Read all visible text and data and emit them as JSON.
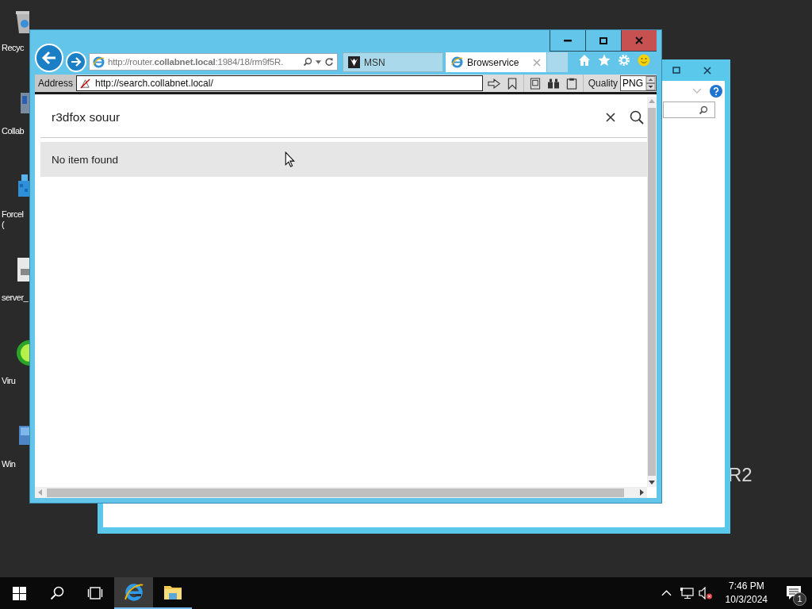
{
  "desktop": {
    "icons": [
      {
        "kind": "recycle",
        "lines": [
          "Recyc"
        ]
      },
      {
        "kind": "app",
        "lines": [
          "Collab"
        ]
      },
      {
        "kind": "cubes",
        "lines": [
          "Forcel",
          "("
        ]
      },
      {
        "kind": "file",
        "lines": [
          "server_"
        ]
      },
      {
        "kind": "virus",
        "lines": [
          "Viru"
        ]
      },
      {
        "kind": "window",
        "lines": [
          "Win"
        ]
      }
    ],
    "wallpaper_text": "R2"
  },
  "browser": {
    "address_bar": {
      "url": "http://router.**collabnet.local**:1984/18/rm9f5R."
    },
    "tabs": [
      {
        "kind": "msn",
        "label": "MSN",
        "selected": false
      },
      {
        "kind": "ie",
        "label": "Browservice",
        "selected": true
      }
    ],
    "toolbar": {
      "address_label": "Address",
      "url": "http://search.collabnet.local/",
      "quality_label": "Quality",
      "quality_value": "PNG"
    },
    "page": {
      "search": {
        "value": "r3dfox souur"
      },
      "results": [
        {
          "text": "No item found"
        }
      ]
    }
  },
  "taskbar": {
    "apps": [
      {
        "kind": "ie",
        "selected": true
      },
      {
        "kind": "explorer",
        "selected": false
      }
    ],
    "clock": {
      "time": "7:46 PM",
      "date": "10/3/2024"
    },
    "notification_count": "1"
  }
}
